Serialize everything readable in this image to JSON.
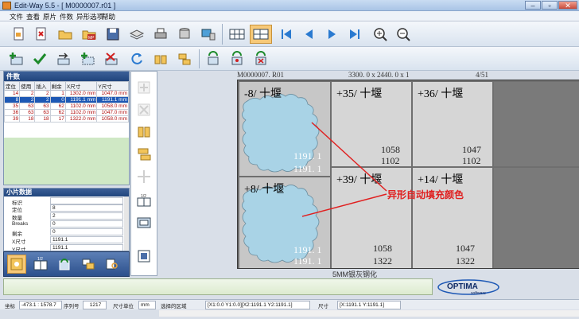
{
  "window": {
    "title": "Edit-Way 5.5 - [ M0000007.r01 ]"
  },
  "menu": {
    "items": [
      "文件",
      "查看",
      "原片",
      "件数",
      "异形选项",
      "帮助"
    ]
  },
  "parts_panel": {
    "title": "件数",
    "columns": [
      "定位",
      "使用",
      "插入",
      "剩余",
      "X尺寸",
      "Y尺寸"
    ],
    "rows": [
      [
        "14",
        "2",
        "2",
        "1",
        "1302.0 mm",
        "1047.0 mm"
      ],
      [
        "8",
        "2",
        "2",
        "0",
        "1191.1 mm",
        "1191.1 mm"
      ],
      [
        "35",
        "63",
        "63",
        "62",
        "1102.0 mm",
        "1058.0 mm"
      ],
      [
        "36",
        "63",
        "63",
        "62",
        "1102.0 mm",
        "1047.0 mm"
      ],
      [
        "39",
        "18",
        "18",
        "17",
        "1322.0 mm",
        "1058.0 mm"
      ]
    ]
  },
  "small_panel": {
    "title": "小片数据",
    "rows": [
      {
        "key": "标识",
        "value": ""
      },
      {
        "key": "定位",
        "value": "8"
      },
      {
        "key": "数量",
        "value": "2"
      },
      {
        "key": "Breaks",
        "value": "0"
      },
      {
        "key": "剩余",
        "value": "0"
      },
      {
        "key": "X尺寸",
        "value": "1191.1"
      },
      {
        "key": "Y尺寸",
        "value": "1191.1"
      }
    ]
  },
  "sheet_header": {
    "name": "M0000007. R01",
    "size": "3300. 0 x  2440. 0 x 1",
    "page": "4/51"
  },
  "cells": [
    {
      "label": "-8/  十堰",
      "n1": "1191. 1",
      "n2": "1191. 1"
    },
    {
      "label": "+35/  十堰",
      "n1": "1058",
      "n2": "1102"
    },
    {
      "label": "+36/  十堰",
      "n1": "1047",
      "n2": "1102"
    },
    {
      "label": "+8/  十堰",
      "n1": "1191. 1",
      "n2": "1191. 1"
    },
    {
      "label": "+39/  十堰",
      "n1": "1058",
      "n2": "1322"
    },
    {
      "label": "+14/  十堰",
      "n1": "1047",
      "n2": "1322"
    }
  ],
  "annotation": "异形自动填充颜色",
  "glass_label": "5MM银灰钢化",
  "logo": {
    "text": "OPTIMA",
    "sub": "software"
  },
  "status": {
    "coord_label": "坐标",
    "coord_value": "-473.1 : 1578.7",
    "seq_label": "序列号",
    "seq_value": "1217",
    "unit_label": "尺寸单位",
    "unit_value": "mm",
    "region_label": "选择的区域",
    "region_value": "[X1:0.0 Y1:0.0][X2:1191.1 Y2:1191.1]",
    "size_label": "尺寸",
    "size_value": "[X:1191.1 Y:1191.1]"
  },
  "colors": {
    "accent": "#1d58b5",
    "shape_fill": "#a9d3e6",
    "annotation": "#e02020"
  }
}
